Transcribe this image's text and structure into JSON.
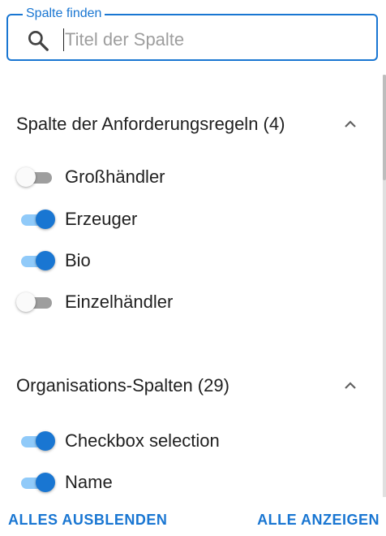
{
  "search": {
    "label": "Spalte finden",
    "placeholder": "Titel der Spalte",
    "value": ""
  },
  "groups": [
    {
      "title": "Spalte der Anforderungsregeln (4)",
      "expanded": true,
      "items": [
        {
          "label": "Großhändler",
          "checked": false
        },
        {
          "label": "Erzeuger",
          "checked": true
        },
        {
          "label": "Bio",
          "checked": true
        },
        {
          "label": "Einzelhändler",
          "checked": false
        }
      ]
    },
    {
      "title": "Organisations-Spalten (29)",
      "expanded": true,
      "items": [
        {
          "label": "Checkbox selection",
          "checked": true
        },
        {
          "label": "Name",
          "checked": true
        }
      ]
    }
  ],
  "footer": {
    "hide_all": "ALLES AUSBLENDEN",
    "show_all": "ALLE ANZEIGEN"
  },
  "colors": {
    "accent": "#1976d2",
    "track_on": "#90caf9",
    "track_off": "#9e9e9e"
  }
}
